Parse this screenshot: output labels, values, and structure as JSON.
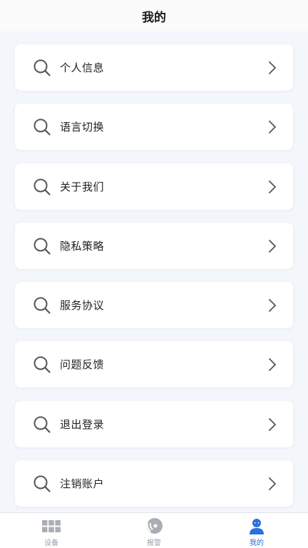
{
  "header": {
    "title": "我的"
  },
  "menu": {
    "items": [
      {
        "label": "个人信息",
        "icon": "search-icon"
      },
      {
        "label": "语言切换",
        "icon": "search-icon"
      },
      {
        "label": "关于我们",
        "icon": "search-icon"
      },
      {
        "label": "隐私策略",
        "icon": "search-icon"
      },
      {
        "label": "服务协议",
        "icon": "search-icon"
      },
      {
        "label": "问题反馈",
        "icon": "search-icon"
      },
      {
        "label": "退出登录",
        "icon": "search-icon"
      },
      {
        "label": "注销账户",
        "icon": "search-icon"
      }
    ]
  },
  "tabbar": {
    "tabs": [
      {
        "label": "设备",
        "icon": "grid-icon",
        "active": false
      },
      {
        "label": "报警",
        "icon": "alarm-icon",
        "active": false
      },
      {
        "label": "我的",
        "icon": "user-icon",
        "active": true
      }
    ]
  },
  "colors": {
    "accent": "#2b6fe0",
    "inactive": "#9aa0a8",
    "background": "#f3f6fb"
  }
}
